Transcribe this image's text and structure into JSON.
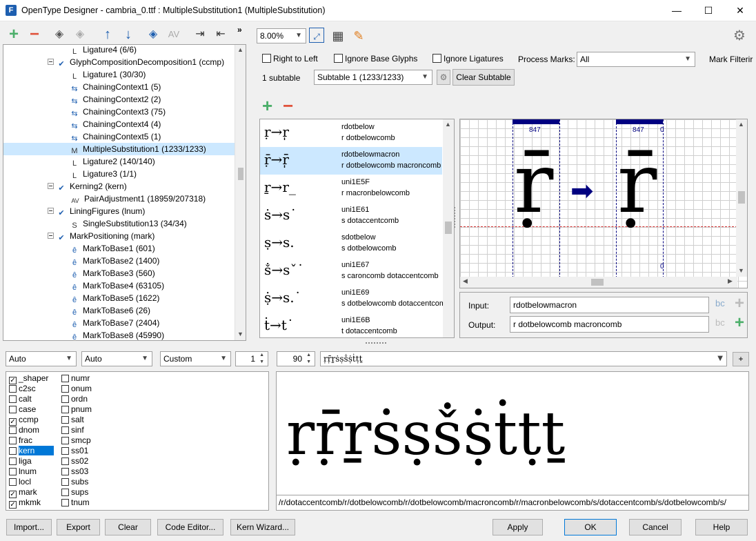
{
  "window": {
    "title": "OpenType Designer - cambria_0.ttf : MultipleSubstitution1 (MultipleSubstitution)",
    "app_icon": "F",
    "minimize": "—",
    "maximize": "☐",
    "close": "✕"
  },
  "toolbar": {
    "more": "»"
  },
  "tree": {
    "items": [
      {
        "label": "Ligature4 (6/6)"
      },
      {
        "label": "GlyphCompositionDecomposition1 (ccmp)"
      },
      {
        "label": "Ligature1 (30/30)"
      },
      {
        "label": "ChainingContext1 (5)"
      },
      {
        "label": "ChainingContext2 (2)"
      },
      {
        "label": "ChainingContext3 (75)"
      },
      {
        "label": "ChainingContext4 (4)"
      },
      {
        "label": "ChainingContext5 (1)"
      },
      {
        "label": "MultipleSubstitution1 (1233/1233)"
      },
      {
        "label": "Ligature2 (140/140)"
      },
      {
        "label": "Ligature3 (1/1)"
      },
      {
        "label": "Kerning2 (kern)"
      },
      {
        "label": "PairAdjustment1 (18959/207318)"
      },
      {
        "label": "LiningFigures (lnum)"
      },
      {
        "label": "SingleSubstitution13 (34/34)"
      },
      {
        "label": "MarkPositioning (mark)"
      },
      {
        "label": "MarkToBase1 (601)"
      },
      {
        "label": "MarkToBase2 (1400)"
      },
      {
        "label": "MarkToBase3 (560)"
      },
      {
        "label": "MarkToBase4 (63105)"
      },
      {
        "label": "MarkToBase5 (1622)"
      },
      {
        "label": "MarkToBase6 (26)"
      },
      {
        "label": "MarkToBase7 (2404)"
      },
      {
        "label": "MarkToBase8 (45990)"
      }
    ]
  },
  "view": {
    "zoom": "8.00%",
    "right_to_left": "Right to Left",
    "ignore_base": "Ignore Base Glyphs",
    "ignore_ligatures": "Ignore Ligatures",
    "process_marks_label": "Process Marks:",
    "process_marks_value": "All",
    "mark_filtering": "Mark Filterir",
    "subtable_count": "1 subtable",
    "subtable_value": "Subtable 1 (1233/1233)",
    "clear_subtable": "Clear Subtable"
  },
  "substitutions": [
    {
      "glyph": "ṛ→r̩",
      "name": "rdotbelow",
      "output": "r dotbelowcomb"
    },
    {
      "glyph": "ṝ→r̩̄",
      "name": "rdotbelowmacron",
      "output": "r dotbelowcomb macroncomb"
    },
    {
      "glyph": "ṟ→r_",
      "name": "uni1E5F",
      "output": "r macronbelowcomb"
    },
    {
      "glyph": "ṡ→s˙",
      "name": "uni1E61",
      "output": "s dotaccentcomb"
    },
    {
      "glyph": "ṣ→s.",
      "name": "sdotbelow",
      "output": "s dotbelowcomb"
    },
    {
      "glyph": "ṧ→sˇ˙",
      "name": "uni1E67",
      "output": "s caroncomb dotaccentcomb"
    },
    {
      "glyph": "ṩ→s.˙",
      "name": "uni1E69",
      "output": "s dotbelowcomb dotaccentcomb"
    },
    {
      "glyph": "ṫ→t˙",
      "name": "uni1E6B",
      "output": "t dotaccentcomb"
    }
  ],
  "canvas": {
    "adv1": "847",
    "adv2": "847",
    "zero_top": "0",
    "zero_bottom": "0",
    "in_glyph": "ṝ",
    "out_glyph": "ṝ",
    "arrow": "➡"
  },
  "io": {
    "input_label": "Input:",
    "input_value": "rdotbelowmacron",
    "output_label": "Output:",
    "output_value": "r dotbelowcomb macroncomb"
  },
  "preview_controls": {
    "script": "Auto",
    "language": "Auto",
    "mode": "Custom",
    "spin": "1",
    "size": "90",
    "text": "ṛṝṟṡṣṧṩṫṭṯ",
    "plus": "+"
  },
  "features": [
    {
      "tag": "_shaper",
      "checked": true
    },
    {
      "tag": "c2sc",
      "checked": false
    },
    {
      "tag": "calt",
      "checked": false
    },
    {
      "tag": "case",
      "checked": false
    },
    {
      "tag": "ccmp",
      "checked": true
    },
    {
      "tag": "dnom",
      "checked": false
    },
    {
      "tag": "frac",
      "checked": false
    },
    {
      "tag": "kern",
      "checked": false
    },
    {
      "tag": "liga",
      "checked": false
    },
    {
      "tag": "lnum",
      "checked": false
    },
    {
      "tag": "locl",
      "checked": false
    },
    {
      "tag": "mark",
      "checked": true
    },
    {
      "tag": "mkmk",
      "checked": true
    },
    {
      "tag": "numr",
      "checked": false
    },
    {
      "tag": "onum",
      "checked": false
    },
    {
      "tag": "ordn",
      "checked": false
    },
    {
      "tag": "pnum",
      "checked": false
    },
    {
      "tag": "salt",
      "checked": false
    },
    {
      "tag": "sinf",
      "checked": false
    },
    {
      "tag": "smcp",
      "checked": false
    },
    {
      "tag": "ss01",
      "checked": false
    },
    {
      "tag": "ss02",
      "checked": false
    },
    {
      "tag": "ss03",
      "checked": false
    },
    {
      "tag": "subs",
      "checked": false
    },
    {
      "tag": "sups",
      "checked": false
    },
    {
      "tag": "tnum",
      "checked": false
    }
  ],
  "preview": {
    "rendered": "ṛṝṟṡṣṧṩṫṭṯ",
    "glyph_path": "/r/dotaccentcomb/r/dotbelowcomb/r/dotbelowcomb/macroncomb/r/macronbelowcomb/s/dotaccentcomb/s/dotbelowcomb/s/"
  },
  "buttons": {
    "import": "Import...",
    "export": "Export",
    "clear": "Clear",
    "code_editor": "Code Editor...",
    "kern_wizard": "Kern Wizard...",
    "apply": "Apply",
    "ok": "OK",
    "cancel": "Cancel",
    "help": "Help"
  },
  "colors": {
    "accent": "#0078d7",
    "selection": "#cce8ff",
    "bar": "#000080",
    "green": "#4caf6a",
    "red": "#e0533c"
  }
}
